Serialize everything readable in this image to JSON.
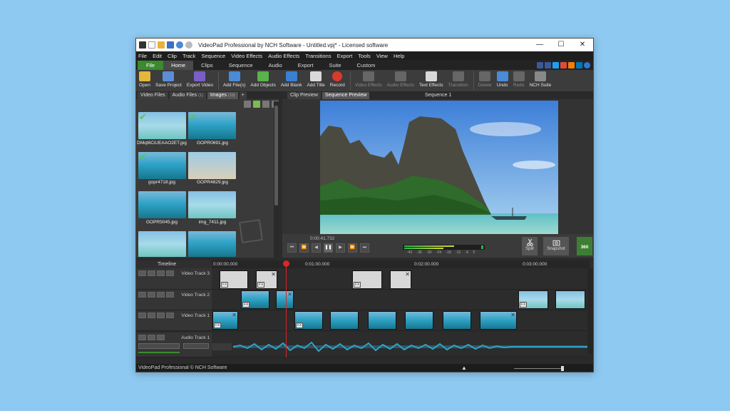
{
  "window": {
    "title": "VideoPad Professional by NCH Software - Untitled.vpj* - Licensed software",
    "minimize": "—",
    "maximize": "☐",
    "close": "✕"
  },
  "menu": [
    "File",
    "Edit",
    "Clip",
    "Track",
    "Sequence",
    "Video Effects",
    "Audio Effects",
    "Transitions",
    "Export",
    "Tools",
    "View",
    "Help"
  ],
  "tabs": [
    "File",
    "Home",
    "Clips",
    "Sequence",
    "Audio",
    "Export",
    "Suite",
    "Custom"
  ],
  "active_tab": "Home",
  "toolbar": {
    "open": "Open",
    "save_project": "Save Project",
    "export_video": "Export Video",
    "add_files": "Add File(s)",
    "add_objects": "Add Objects",
    "add_blank": "Add Blank",
    "add_title": "Add Title",
    "record": "Record",
    "video_effects": "Video Effects",
    "audio_effects": "Audio Effects",
    "text_effects": "Text Effects",
    "transition": "Transition",
    "delete": "Delete",
    "undo": "Undo",
    "redo": "Redo",
    "nch_suite": "NCH Suite"
  },
  "media_tabs": {
    "video_files": "Video Files",
    "audio_files": "Audio Files",
    "audio_count": "(1)",
    "images": "Images",
    "images_count": "(10)",
    "plus": "+"
  },
  "media_items": [
    {
      "name": "DMqt6CiUEAAO2ET.jpg",
      "checked": true
    },
    {
      "name": "GOPR0691.jpg",
      "checked": true
    },
    {
      "name": "gopr4718.jpg",
      "checked": true
    },
    {
      "name": "GOPR4829.jpg",
      "checked": false
    },
    {
      "name": "GOPR5045.jpg",
      "checked": false
    },
    {
      "name": "img_7411.jpg",
      "checked": false
    }
  ],
  "preview": {
    "clip_preview": "Clip Preview",
    "sequence_preview": "Sequence Preview",
    "sequence_title": "Sequence 1",
    "timecode": "0:00:41.732",
    "vu_labels": "-42 -36 -30 -24 -18 -12 -6 0",
    "split": "Split",
    "snapshot": "Snapshot",
    "b360": "360"
  },
  "timeline": {
    "label": "Timeline",
    "ticks": [
      "0:00:00.000",
      "0:01:00.000",
      "0:02:00.000",
      "0:03:00.000"
    ],
    "tracks": [
      "Video Track 3",
      "Video Track 2",
      "Video Track 1",
      "Audio Track 1"
    ]
  },
  "status": {
    "text": "VideoPad Professional © NCH Software"
  },
  "colors": {
    "accent_green": "#3b8a2e",
    "playhead": "#d62828",
    "waveform": "#2fa3c7"
  }
}
